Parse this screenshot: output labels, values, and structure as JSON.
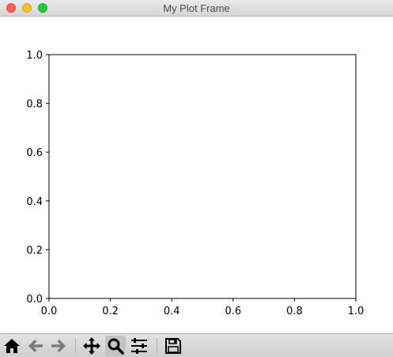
{
  "window": {
    "title": "My Plot Frame"
  },
  "plot": {
    "x_ticks": [
      "0.0",
      "0.2",
      "0.4",
      "0.6",
      "0.8",
      "1.0"
    ],
    "y_ticks": [
      "0.0",
      "0.2",
      "0.4",
      "0.6",
      "0.8",
      "1.0"
    ],
    "xlim": [
      0,
      1
    ],
    "ylim": [
      0,
      1
    ]
  },
  "toolbar": {
    "buttons": [
      "home-icon",
      "back-arrow-icon",
      "forward-arrow-icon",
      "pan-icon",
      "zoom-icon",
      "configure-subplots-icon",
      "save-icon"
    ],
    "active": "zoom-icon",
    "disabled_color": "#7a7a7a",
    "enabled_color": "#000000"
  }
}
